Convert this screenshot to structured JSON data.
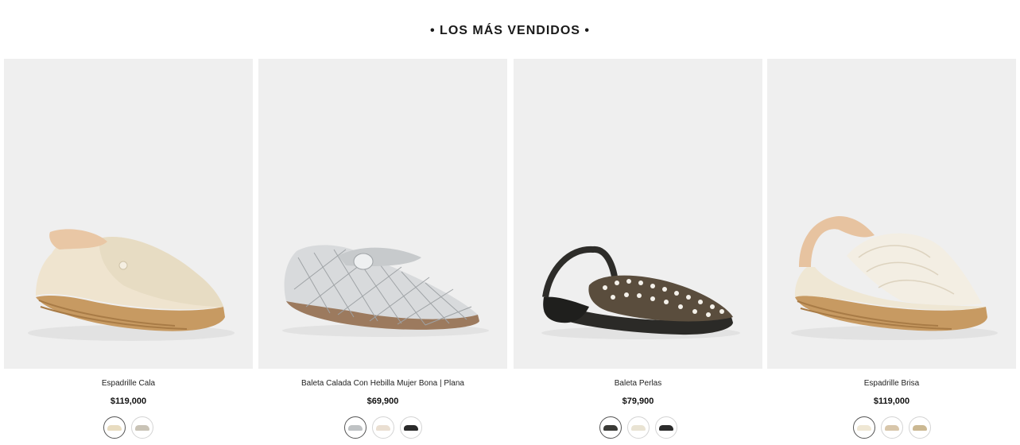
{
  "section": {
    "title": "• LOS MÁS VENDIDOS •"
  },
  "products": [
    {
      "name": "Espadrille Cala",
      "price": "$119,000",
      "swatches": [
        {
          "color": "#e8dcc0",
          "selected": true
        },
        {
          "color": "#c9c3b6",
          "selected": false
        }
      ]
    },
    {
      "name": "Baleta Calada Con Hebilla Mujer Bona | Plana",
      "price": "$69,900",
      "swatches": [
        {
          "color": "#bfc2c4",
          "selected": true
        },
        {
          "color": "#eadfd2",
          "selected": false
        },
        {
          "color": "#2a2a2a",
          "selected": false
        }
      ]
    },
    {
      "name": "Baleta Perlas",
      "price": "$79,900",
      "swatches": [
        {
          "color": "#3a3a36",
          "selected": true
        },
        {
          "color": "#e9e3d3",
          "selected": false
        },
        {
          "color": "#2b2b2b",
          "selected": false
        }
      ]
    },
    {
      "name": "Espadrille Brisa",
      "price": "$119,000",
      "swatches": [
        {
          "color": "#efe7d4",
          "selected": true
        },
        {
          "color": "#d8c6aa",
          "selected": false
        },
        {
          "color": "#cbb892",
          "selected": false
        }
      ]
    }
  ]
}
